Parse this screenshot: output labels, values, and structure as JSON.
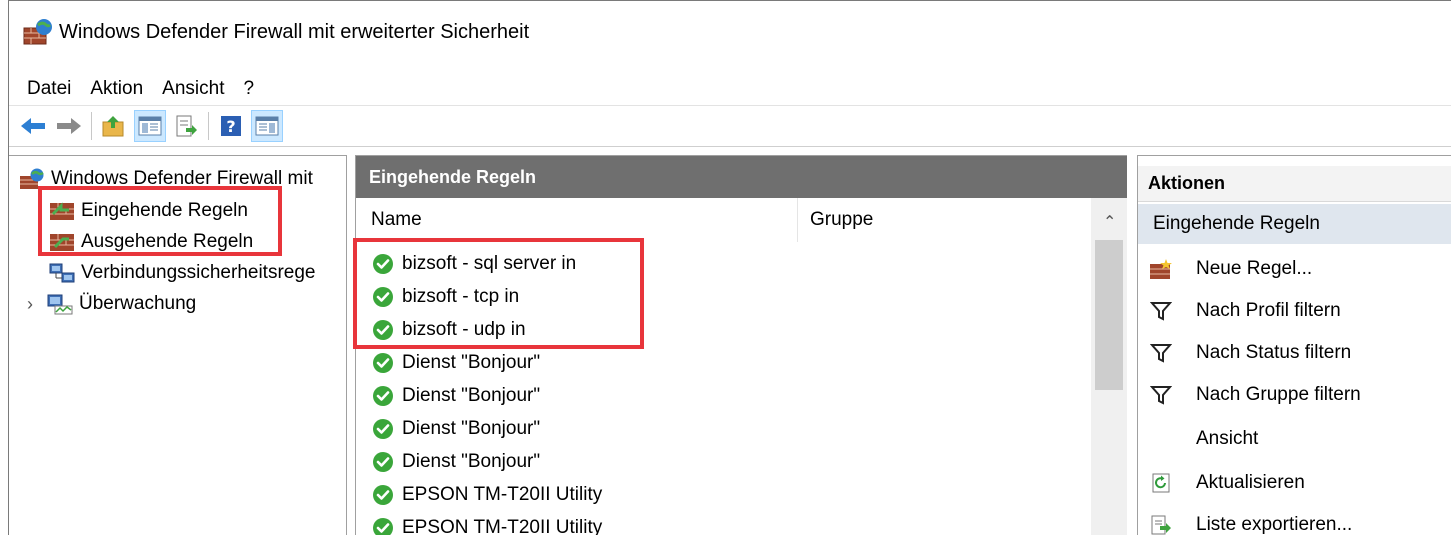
{
  "window": {
    "title": "Windows Defender Firewall mit erweiterter Sicherheit"
  },
  "menu": {
    "items": [
      "Datei",
      "Aktion",
      "Ansicht",
      "?"
    ]
  },
  "toolbar": {
    "buttons": [
      "back-arrow-icon",
      "forward-arrow-icon",
      "up-folder-icon",
      "show-hide-tree-icon",
      "export-list-icon",
      "help-icon",
      "show-hide-action-pane-icon"
    ]
  },
  "tree": {
    "root": "Windows Defender Firewall mit",
    "items": [
      {
        "label": "Eingehende Regeln"
      },
      {
        "label": "Ausgehende Regeln"
      },
      {
        "label": "Verbindungssicherheitsrege"
      },
      {
        "label": "Überwachung"
      }
    ]
  },
  "center": {
    "header": "Eingehende Regeln",
    "columns": {
      "name": "Name",
      "group": "Gruppe"
    },
    "rows": [
      "bizsoft - sql server in",
      "bizsoft - tcp in",
      "bizsoft - udp in",
      "Dienst \"Bonjour\"",
      "Dienst \"Bonjour\"",
      "Dienst \"Bonjour\"",
      "Dienst \"Bonjour\"",
      "EPSON TM-T20II Utility",
      "EPSON TM-T20II Utility"
    ]
  },
  "actions": {
    "header": "Aktionen",
    "section": "Eingehende Regeln",
    "items": [
      {
        "label": "Neue Regel...",
        "icon": "new-rule-icon"
      },
      {
        "label": "Nach Profil filtern",
        "icon": "filter-icon"
      },
      {
        "label": "Nach Status filtern",
        "icon": "filter-icon"
      },
      {
        "label": "Nach Gruppe filtern",
        "icon": "filter-icon"
      },
      {
        "label": "Ansicht",
        "icon": ""
      },
      {
        "label": "Aktualisieren",
        "icon": "refresh-icon"
      },
      {
        "label": "Liste exportieren...",
        "icon": "export-icon"
      }
    ]
  },
  "colors": {
    "highlight": "#e8353b",
    "pane_header": "#6f6f6f",
    "actions_section": "#dfe6ee",
    "check_green": "#3aa63a"
  }
}
